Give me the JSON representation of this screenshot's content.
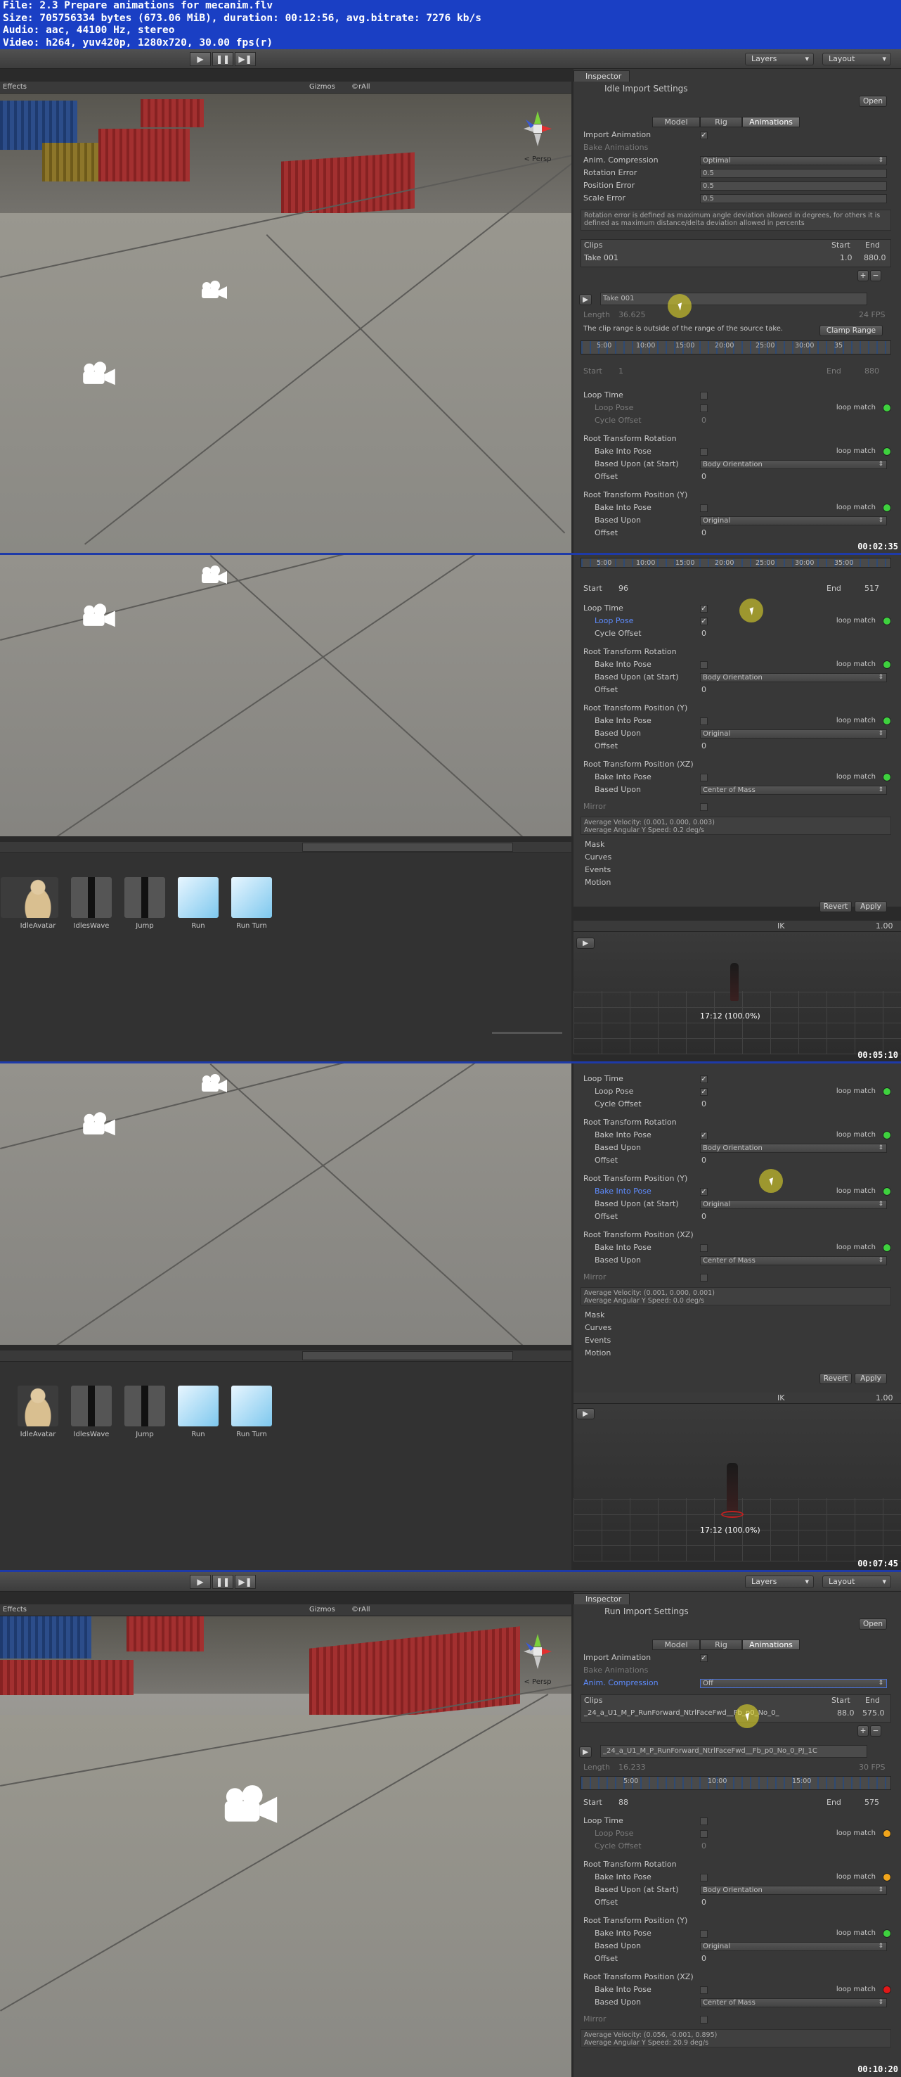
{
  "header": {
    "line1": "File: 2.3 Prepare animations for mecanim.flv",
    "line2": "Size: 705756334 bytes (673.06 MiB), duration: 00:12:56, avg.bitrate: 7276 kb/s",
    "line3": "Audio: aac, 44100 Hz, stereo",
    "line4": "Video: h264, yuv420p, 1280x720, 30.00 fps(r)"
  },
  "toolbar": {
    "layers": "Layers",
    "layout": "Layout",
    "play": "▶",
    "pause": "❚❚",
    "step": "▶❚"
  },
  "scene": {
    "effects": "Effects",
    "gizmos": "Gizmos",
    "search": "©rAll",
    "persp": "< Persp",
    "x": "x",
    "y": "y"
  },
  "frame1": {
    "timestamp": "00:02:35",
    "inspector_tab": "Inspector",
    "title": "Idle Import Settings",
    "open": "Open",
    "tabs": [
      "Model",
      "Rig",
      "Animations"
    ],
    "import_animation": "Import Animation",
    "bake_animations": "Bake Animations",
    "anim_compression": "Anim. Compression",
    "anim_compression_val": "Optimal",
    "rotation_error": "Rotation Error",
    "rotation_error_val": "0.5",
    "position_error": "Position Error",
    "position_error_val": "0.5",
    "scale_error": "Scale Error",
    "scale_error_val": "0.5",
    "note": "Rotation error is defined as maximum angle deviation allowed in degrees, for others it is defined as maximum distance/delta deviation allowed in percents",
    "clips_hdr": "Clips",
    "start_hdr": "Start",
    "end_hdr": "End",
    "clip_name": "Take 001",
    "clip_start": "1.0",
    "clip_end": "880.0",
    "take_name": "Take 001",
    "length": "Length",
    "length_val": "36.625",
    "fps": "24 FPS",
    "warn": "The clip range is outside of the range of the source take.",
    "clamp": "Clamp Range",
    "tl": [
      "5:00",
      "10:00",
      "15:00",
      "20:00",
      "25:00",
      "30:00",
      "35"
    ],
    "start": "Start",
    "start_val": "1",
    "end": "End",
    "end_val": "880",
    "loop_time": "Loop Time",
    "loop_pose": "Loop Pose",
    "cycle_offset": "Cycle Offset",
    "cycle_offset_val": "0",
    "rtr": "Root Transform Rotation",
    "bake_into_pose": "Bake Into Pose",
    "based_upon_start": "Based Upon (at Start)",
    "body_orientation": "Body Orientation",
    "offset": "Offset",
    "offset_val": "0",
    "rtpy": "Root Transform Position (Y)",
    "based_upon": "Based Upon",
    "original": "Original",
    "loop_match": "loop match"
  },
  "frame2": {
    "timestamp": "00:05:10",
    "tl": [
      "5:00",
      "10:00",
      "15:00",
      "20:00",
      "25:00",
      "30:00",
      "35:00"
    ],
    "start_val": "96",
    "end_val": "517",
    "rtpxz": "Root Transform Position (XZ)",
    "center_of_mass": "Center of Mass",
    "mirror": "Mirror",
    "avg1": "Average Velocity: (0.001, 0.000, 0.003)",
    "avg2": "Average Angular Y Speed: 0.2 deg/s",
    "folds": [
      "Mask",
      "Curves",
      "Events",
      "Motion"
    ],
    "revert": "Revert",
    "apply": "Apply",
    "ik": "IK",
    "speed": "1.00",
    "preview_label": "17:12 (100.0%)",
    "assets": [
      "IdleAvatar",
      "IdlesWave",
      "Jump",
      "Run",
      "Run Turn"
    ]
  },
  "frame3": {
    "timestamp": "00:07:45",
    "avg1": "Average Velocity: (0.001, 0.000, 0.001)",
    "avg2": "Average Angular Y Speed: 0.0 deg/s"
  },
  "frame4": {
    "timestamp": "00:10:20",
    "title": "Run Import Settings",
    "anim_compression_val": "Off",
    "clip_name": "_24_a_U1_M_P_RunForward_NtrlFaceFwd__Fb_p0_No_0_",
    "clip_start": "88.0",
    "clip_end": "575.0",
    "take_name": "_24_a_U1_M_P_RunForward_NtrlFaceFwd__Fb_p0_No_0_PJ_1C",
    "length_val": "16.233",
    "fps": "30 FPS",
    "tl": [
      "5:00",
      "10:00",
      "15:00"
    ],
    "start_val": "88",
    "end_val": "575",
    "avg1": "Average Velocity: (0.056, -0.001, 0.895)",
    "avg2": "Average Angular Y Speed: 20.9 deg/s"
  }
}
